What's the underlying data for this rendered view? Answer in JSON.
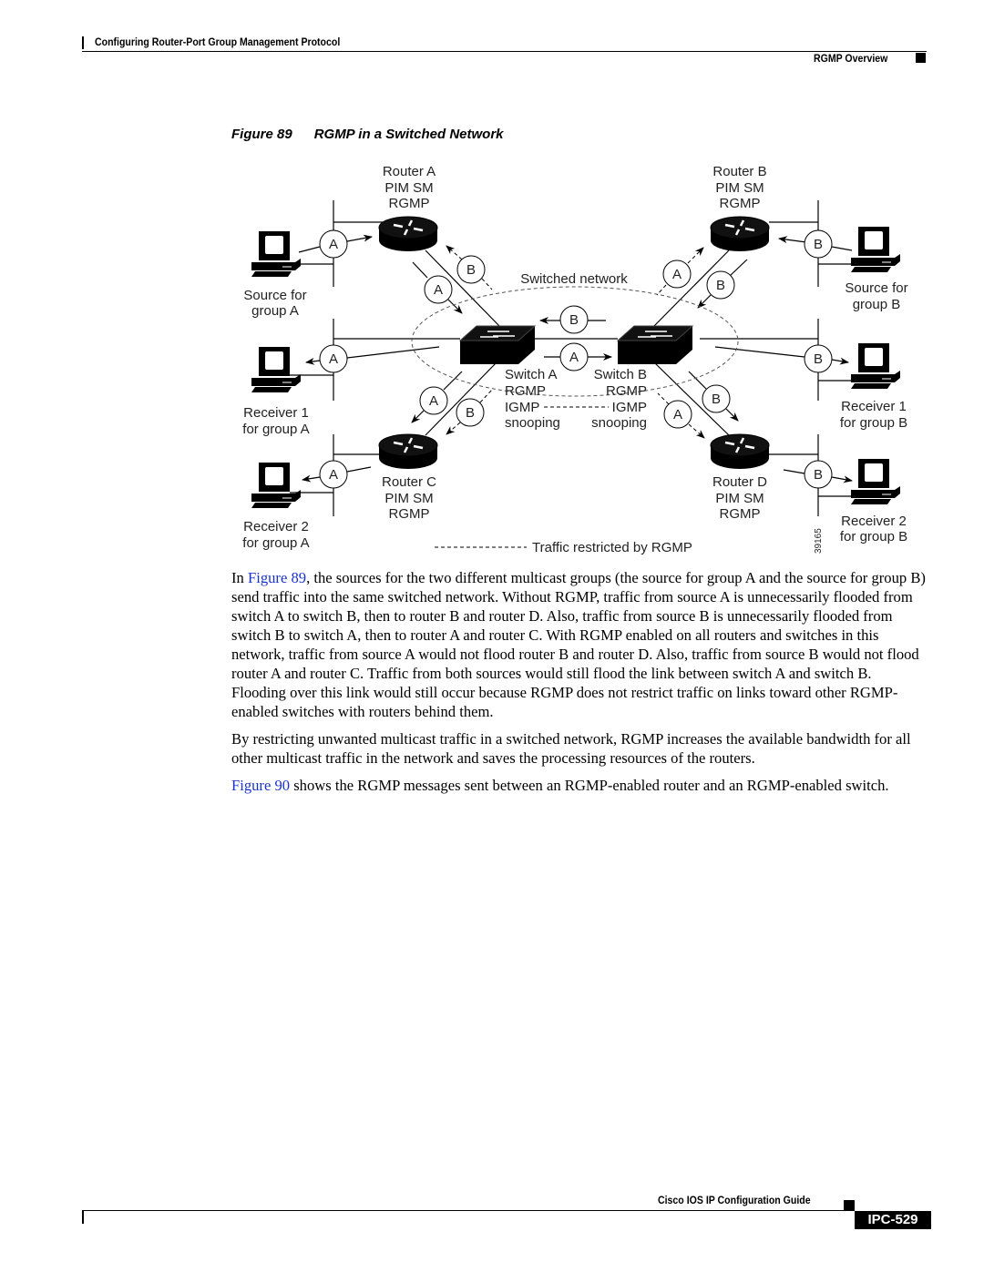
{
  "header": {
    "chapter": "Configuring Router-Port Group Management Protocol",
    "section": "RGMP Overview"
  },
  "figure": {
    "number": "Figure 89",
    "title": "RGMP in a Switched Network",
    "router_a": [
      "Router A",
      "PIM SM",
      "RGMP"
    ],
    "router_b": [
      "Router B",
      "PIM SM",
      "RGMP"
    ],
    "router_c": [
      "Router C",
      "PIM SM",
      "RGMP"
    ],
    "router_d": [
      "Router D",
      "PIM SM",
      "RGMP"
    ],
    "switch_a": [
      "Switch A",
      "RGMP",
      "IGMP",
      "snooping"
    ],
    "switch_b": [
      "Switch B",
      "RGMP",
      "IGMP",
      "snooping"
    ],
    "source_a": [
      "Source for",
      "group A"
    ],
    "receiver1_a": [
      "Receiver 1",
      "for group A"
    ],
    "receiver2_a": [
      "Receiver 2",
      "for group A"
    ],
    "source_b": [
      "Source for",
      "group B"
    ],
    "receiver1_b": [
      "Receiver 1",
      "for group B"
    ],
    "receiver2_b": [
      "Receiver 2",
      "for group B"
    ],
    "switched_network": "Switched network",
    "legend": "Traffic restricted by RGMP",
    "figure_id": "39165",
    "marker_a": "A",
    "marker_b": "B"
  },
  "body": {
    "p1_link": "Figure 89",
    "p1": ", the sources for the two different multicast groups (the source for group A and the source for group B) send traffic into the same switched network. Without RGMP, traffic from source A is unnecessarily flooded from switch A to switch B, then to router B and router D. Also, traffic from source B is unnecessarily flooded from switch B to switch A, then to router A and router C. With RGMP enabled on all routers and switches in this network, traffic from source A would not flood router B and router D. Also, traffic from source B would not flood router A and router C. Traffic from both sources would still flood the link between switch A and switch B. Flooding over this link would still occur because RGMP does not restrict traffic on links toward other RGMP-enabled switches with routers behind them.",
    "p1_prefix": "In ",
    "p2": "By restricting unwanted multicast traffic in a switched network, RGMP increases the available bandwidth for all other multicast traffic in the network and saves the processing resources of the routers.",
    "p3_link": "Figure 90",
    "p3": " shows the RGMP messages sent between an RGMP-enabled router and an RGMP-enabled switch."
  },
  "footer": {
    "guide": "Cisco IOS IP Configuration Guide",
    "page": "IPC-529"
  }
}
